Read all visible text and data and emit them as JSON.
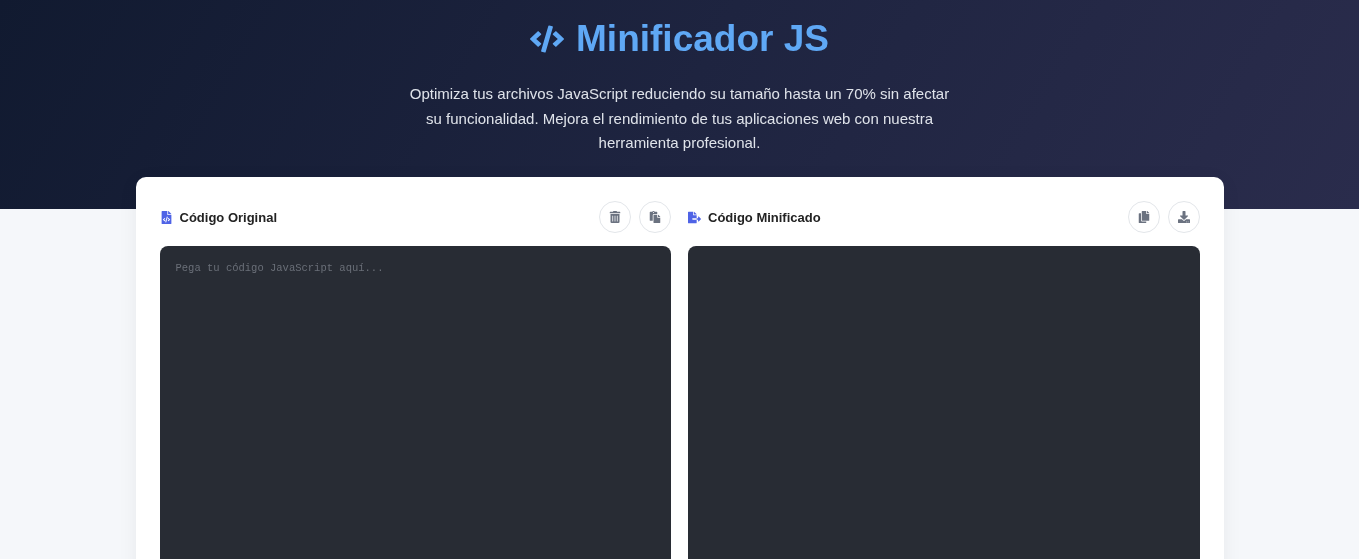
{
  "header": {
    "title": "Minificador JS",
    "description": "Optimiza tus archivos JavaScript reduciendo su tamaño hasta un 70% sin afectar su funcionalidad. Mejora el rendimiento de tus aplicaciones web con nuestra herramienta profesional."
  },
  "panels": [
    {
      "kind": "input",
      "title": "Código Original",
      "placeholder": "Pega tu código JavaScript aquí...",
      "actions": [
        {
          "kind": "clear"
        },
        {
          "kind": "paste"
        }
      ]
    },
    {
      "kind": "output",
      "title": "Código Minificado",
      "actions": [
        {
          "kind": "copy"
        },
        {
          "kind": "download"
        }
      ]
    }
  ]
}
